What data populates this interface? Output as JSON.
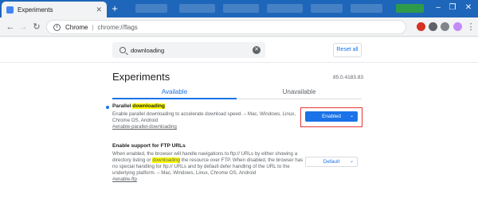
{
  "browser": {
    "active_tab": {
      "title": "Experiments",
      "close": "✕"
    },
    "new_tab": "+",
    "window_controls": [
      "–",
      "❐",
      "✕"
    ]
  },
  "toolbar": {
    "back": "←",
    "forward": "→",
    "reload": "↻",
    "omnibox": {
      "site": "Chrome",
      "separator": "|",
      "url": "chrome://flags",
      "info": "i"
    },
    "menu": "⋮"
  },
  "search": {
    "value": "downloading",
    "clear": "✕"
  },
  "reset_all": "Reset all",
  "page_title": "Experiments",
  "version": "85.0.4183.83",
  "tabs": [
    {
      "label": "Available",
      "active": true
    },
    {
      "label": "Unavailable",
      "active": false
    }
  ],
  "experiments": [
    {
      "name_prefix": "Parallel ",
      "name_highlight": "downloading",
      "description": "Enable parallel downloading to accelerate download speed. – Mac, Windows, Linux, Chrome OS, Android",
      "link": "#enable-parallel-downloading",
      "select_value": "Enabled",
      "chevron": "⌄"
    },
    {
      "name": "Enable support for FTP URLs",
      "desc_part1": "When enabled, the browser will handle navigations to ftp:// URLs by either showing a directory listing or ",
      "desc_highlight": "downloading",
      "desc_part2": " the resource over FTP. When disabled, the browser has no special handling for ftp:// URLs and by default defer handling of the URL to the underlying platform. – Mac, Windows, Linux, Chrome OS, Android",
      "link": "#enable-ftp",
      "select_value": "Default",
      "chevron": "⌄"
    }
  ],
  "colors": {
    "accent": "#1a73e8",
    "tabstrip": "#1e66b9",
    "highlight": "#ffff00",
    "annotation_box": "#e53935"
  }
}
